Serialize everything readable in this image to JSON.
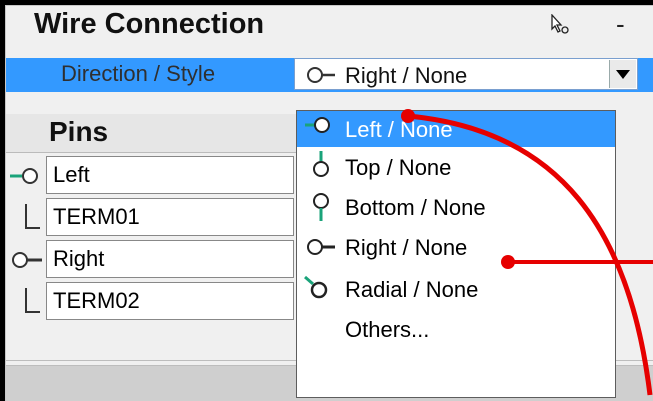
{
  "panel": {
    "title": "Wire Connection",
    "minimize_label": "-"
  },
  "property": {
    "label": "Direction / Style",
    "value": "Right / None"
  },
  "pins": {
    "header": "Pins",
    "rows": [
      {
        "icon": "left-pin-icon",
        "label": "Left"
      },
      {
        "icon": "branch-icon",
        "label": "TERM01"
      },
      {
        "icon": "right-pin-icon",
        "label": "Right"
      },
      {
        "icon": "branch-icon",
        "label": "TERM02"
      }
    ]
  },
  "dropdown": {
    "selected_index": 0,
    "options": [
      {
        "icon": "left-pin-icon",
        "label": "Left / None"
      },
      {
        "icon": "top-pin-icon",
        "label": "Top / None"
      },
      {
        "icon": "bottom-pin-icon",
        "label": "Bottom / None"
      },
      {
        "icon": "right-pin-icon",
        "label": "Right / None"
      },
      {
        "icon": "radial-pin-icon",
        "label": "Radial / None"
      },
      {
        "icon": "",
        "label": "Others..."
      }
    ]
  },
  "colors": {
    "selection": "#3399ff",
    "annotation": "#e60000",
    "pin_accent": "#1aa37a"
  }
}
